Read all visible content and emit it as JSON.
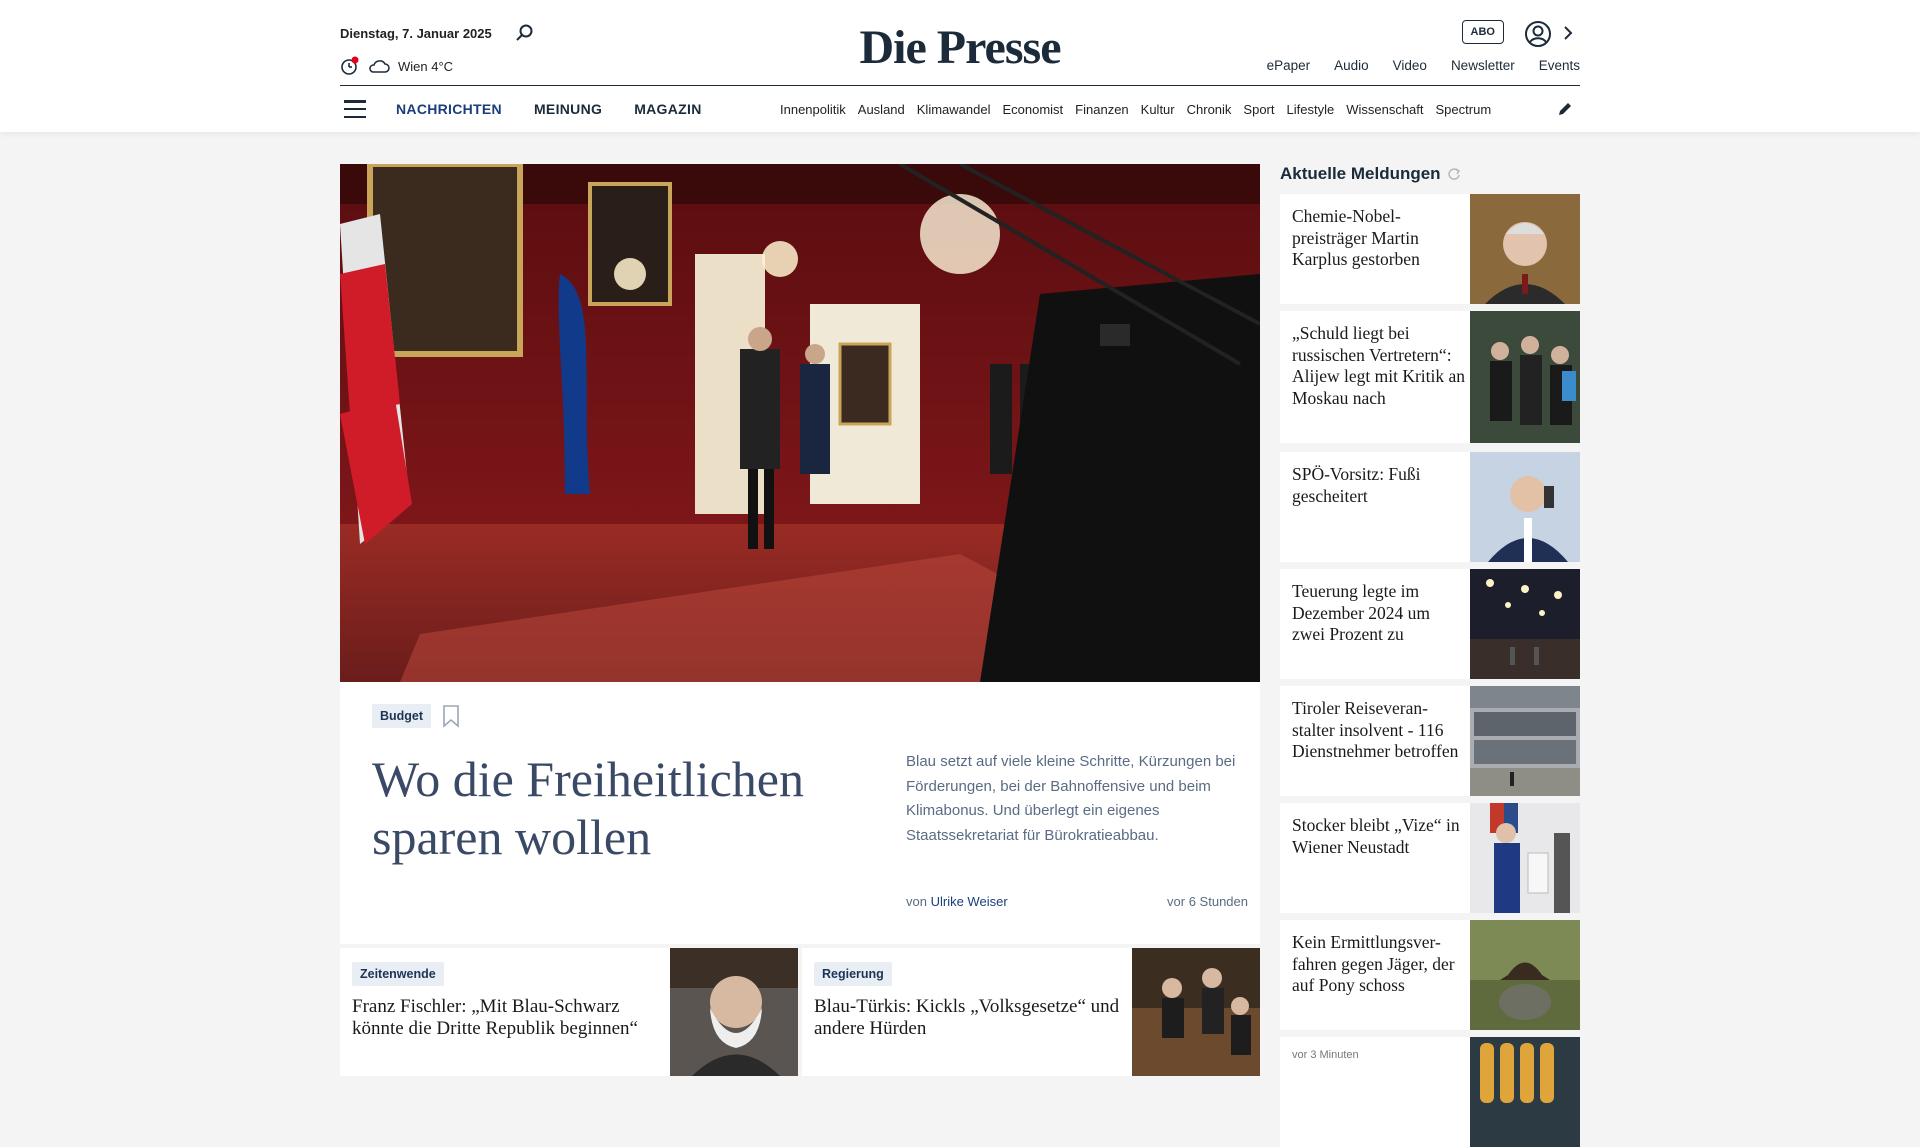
{
  "header": {
    "date": "Dienstag, 7. Januar 2025",
    "weather": "Wien 4°C",
    "logo": "Die Presse",
    "abo": "ABO",
    "toplinks": [
      "ePaper",
      "Audio",
      "Video",
      "Newsletter",
      "Events"
    ],
    "mainnav": [
      "NACHRICHTEN",
      "MEINUNG",
      "MAGAZIN"
    ],
    "subnav": [
      "Innenpolitik",
      "Ausland",
      "Klimawandel",
      "Economist",
      "Finanzen",
      "Kultur",
      "Chronik",
      "Sport",
      "Lifestyle",
      "Wissenschaft",
      "Spectrum"
    ]
  },
  "hero": {
    "tag": "Budget",
    "title": "Wo die Freiheitlichen sparen wollen",
    "lead": "Blau setzt auf viele kleine Schritte, Kürzungen bei Förderungen, bei der Bahnoffensive und beim Klimabonus. Und überlegt ein eigenes Staatssekretariat für Bürokratieabbau.",
    "byline_prefix": "von",
    "author": "Ulrike Weiser",
    "ago": "vor 6 Stunden"
  },
  "cards": [
    {
      "tag": "Zeitenwende",
      "title": "Franz Fischler: „Mit Blau-Schwarz könnte die Dritte Republik beginnen“"
    },
    {
      "tag": "Regierung",
      "title": "Blau-Türkis: Kickls „Volksgesetze“ und andere Hürden"
    }
  ],
  "sidebar": {
    "heading": "Aktuelle Meldungen",
    "items": [
      {
        "title": "Chemie-Nobel-preisträger Martin Karplus gestorben"
      },
      {
        "title": "„Schuld liegt bei russischen Vertretern“: Alijew legt mit Kritik an Moskau nach"
      },
      {
        "title": "SPÖ-Vorsitz: Fußi gescheitert"
      },
      {
        "title": "Teuerung legte im Dezember 2024 um zwei Prozent zu"
      },
      {
        "title": "Tiroler Reiseveran-stalter insolvent - 116 Dienstnehmer betroffen"
      },
      {
        "title": "Stocker bleibt „Vize“ in Wiener Neustadt"
      },
      {
        "title": "Kein Ermittlungsver-fahren gegen Jäger, der auf Pony schoss"
      },
      {
        "small": "vor 3 Minuten"
      }
    ]
  }
}
